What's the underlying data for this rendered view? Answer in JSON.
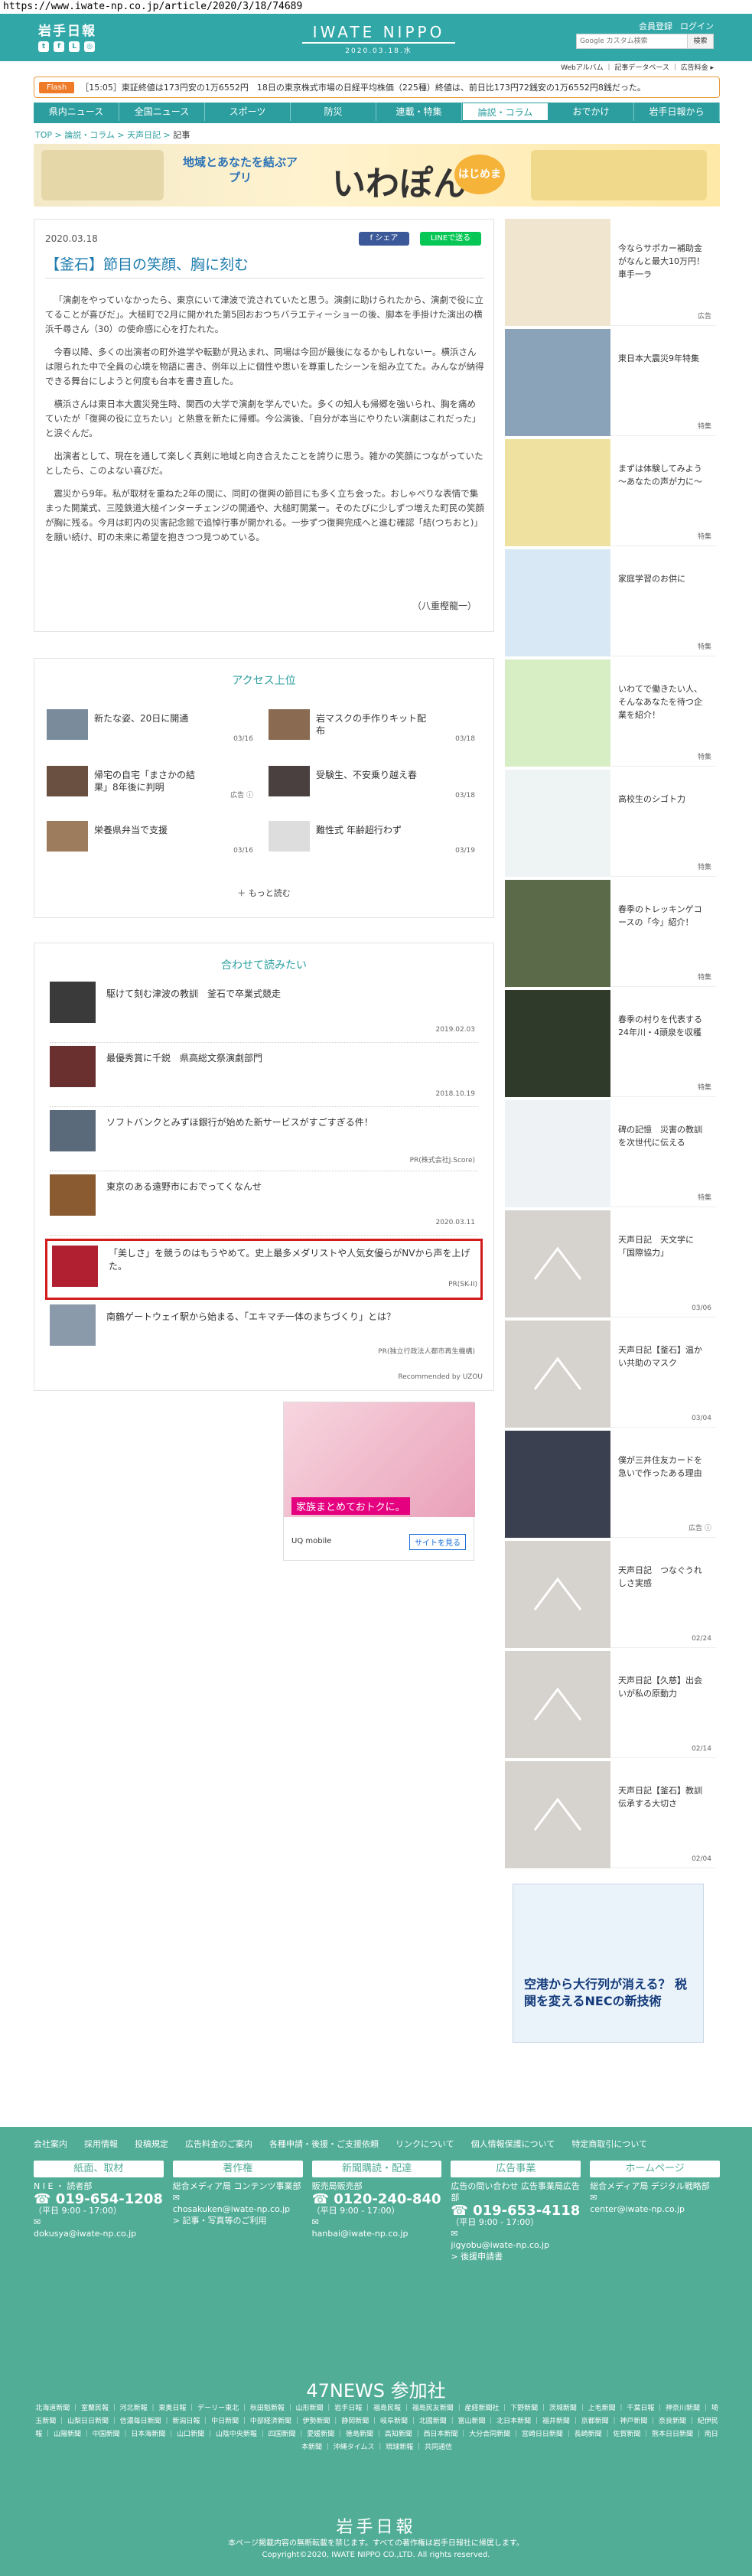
{
  "url": "https://www.iwate-np.co.jp/article/2020/3/18/74689",
  "header": {
    "logo": "岩手日報",
    "brand": "IWATE NIPPO",
    "date": "2020.03.18.水",
    "member": "会員登録",
    "login": "ログイン",
    "search_placeholder": "Google カスタム検索",
    "search_btn": "検索",
    "sub": "Webアルバム ｜ 記事データベース ｜ 広告料金 ▸"
  },
  "flash": {
    "tag": "Flash",
    "text": "［15:05］東証終値は173円安の1万6552円　18日の東京株式市場の日経平均株価（225種）終値は、前日比173円72銭安の1万6552円8銭だった。"
  },
  "nav": [
    "県内ニュース",
    "全国ニュース",
    "スポーツ",
    "防災",
    "連載・特集",
    "論説・コラム",
    "おでかけ",
    "岩手日報から"
  ],
  "breadcrumb": {
    "a": "TOP",
    "b": "論説・コラム",
    "c": "天声日記",
    "d": "記事"
  },
  "banner": {
    "t1": "地域とあなたを結ぶアプリ",
    "t2": "いわぽん",
    "t3": "はじめました"
  },
  "article": {
    "date": "2020.03.18",
    "share": "シェア",
    "line": "LINEで送る",
    "title": "【釜石】節目の笑顔、胸に刻む",
    "paras": [
      "「演劇をやっていなかったら、東京にいて津波で流されていたと思う。演劇に助けられたから、演劇で役に立てることが喜びだ」。大槌町で2月に開かれた第5回おおつちバラエティーショーの後、脚本を手掛けた演出の横浜千尋さん（30）の使命感に心を打たれた。",
      "今春以降、多くの出演者の町外進学や転勤が見込まれ、同場は今回が最後になるかもしれないー。横浜さんは限られた中で全員の心境を物語に書き、例年以上に個性や思いを尊重したシーンを組み立てた。みんなが納得できる舞台にしようと何度も台本を書き直した。",
      "横浜さんは東日本大震災発生時、関西の大学で演劇を学んでいた。多くの知人も帰郷を強いられ、胸を痛めていたが「復興の役に立ちたい」と熱意を新たに帰郷。今公演後、「自分が本当にやりたい演劇はこれだった」と涙ぐんだ。",
      "出演者として、現在を通して楽しく真剣に地域と向き合えたことを誇りに思う。雑かの笑顔につながっていたとしたら、このよない喜びだ。",
      "震災から9年。私が取材を重ねた2年の間に、同町の復興の節目にも多く立ち会った。おしゃべりな表情で集まった開業式、三陸鉄道大槌インターチェンジの開通や、大槌町開業ー。そのたびに少しずつ増えた町民の笑顔が胸に残る。今月は町内の災害記念館で追悼行事が開かれる。一歩ずつ復興完成へと進む確認「結(つちおと)」を願い続け、町の未来に希望を抱きつつ見つめている。"
    ],
    "signature": "（八重樫龍一）"
  },
  "ranking": {
    "title": "アクセス上位",
    "items": [
      {
        "t": "新たな姿、20日に開通",
        "d": "03/16"
      },
      {
        "t": "岩マスクの手作りキット配布",
        "d": "03/18"
      },
      {
        "t": "帰宅の自宅「まさかの結果」8年後に判明",
        "d": "広告 ⓘ"
      },
      {
        "t": "受験生、不安乗り越え春",
        "d": "03/18"
      },
      {
        "t": "栄養県弁当で支援",
        "d": "03/16"
      },
      {
        "t": "難性式 年齢超行わず",
        "d": "03/19"
      }
    ],
    "more": "もっと読む"
  },
  "related": {
    "title": "合わせて読みたい",
    "items": [
      {
        "t": "駆けて刻む津波の教訓　釜石で卒業式競走",
        "d": "2019.02.03"
      },
      {
        "t": "最優秀賞に千鋭　県高総文祭演劇部門",
        "d": "2018.10.19"
      },
      {
        "t": "ソフトバンクとみずほ銀行が始めた新サービスがすごすぎる件！",
        "d": "PR(株式会社J.Score)"
      },
      {
        "t": "東京のある遠野市におでってくなんせ",
        "d": "2020.03.11"
      },
      {
        "t": "「美しさ」を競うのはもうやめて。史上最多メダリストや人気女優らがNVから声を上げた。",
        "d": "PR(SK-II)"
      },
      {
        "t": "南鶴ゲートウェイ駅から始まる、「エキマチ一体のまちづくり」とは？",
        "d": "PR(独立行政法人都市再生機構)"
      }
    ],
    "recommended": "Recommended by UZOU"
  },
  "ad": {
    "text": "家族まとめておトクに。",
    "brand": "UQ mobile",
    "cta": "サイトを見る"
  },
  "sidebar": [
    {
      "t": "今ならサポカー補助金がなんと最大10万円！車手一ラ",
      "tag": "広告"
    },
    {
      "t": "東日本大震災9年特集",
      "tag": "特集"
    },
    {
      "t": "まずは体験してみよう～あなたの声が力に～",
      "tag": "特集"
    },
    {
      "t": "家庭学習のお供に",
      "tag": "特集"
    },
    {
      "t": "いわてで働きたい人、そんなあなたを待つ企業を紹介！",
      "tag": "特集"
    },
    {
      "t": "高校生のシゴト力",
      "tag": "特集"
    },
    {
      "t": "春季のトレッキンゲコースの「今」紹介！",
      "tag": "特集"
    },
    {
      "t": "春季の村りを代表する24年川・4頭泉を収穫",
      "tag": "特集"
    },
    {
      "t": "碑の記憶　災害の教訓を次世代に伝える",
      "tag": "特集"
    },
    {
      "t": "天声日記　天文学に「国際協力」",
      "tag": "03/06"
    },
    {
      "t": "天声日記【釜石】温かい共助のマスク",
      "tag": "03/04"
    },
    {
      "t": "僕が三井住友カードを急いで作ったある理由",
      "tag": "広告 ⓘ"
    },
    {
      "t": "天声日記　つなぐうれしさ実感",
      "tag": "02/24"
    },
    {
      "t": "天声日記【久慈】出会いが私の原動力",
      "tag": "02/14"
    },
    {
      "t": "天声日記【釜石】教訓伝承する大切さ",
      "tag": "02/04"
    },
    {
      "t": "空港から大行列が消える？ 税関を変えるNECの新技術",
      "tag": ""
    }
  ],
  "footer": {
    "links": [
      "会社案内",
      "採用情報",
      "投稿規定",
      "広告料金のご案内",
      "各種申請・後援・ご支援依頼",
      "リンクについて",
      "個人情報保護について",
      "特定商取引について"
    ],
    "cols": [
      {
        "h": "紙面、取材",
        "sub": "N I E ・ 読者部",
        "tel": "019-654-1208",
        "hours": "（平日 9:00 - 17:00）",
        "mail": "dokusya@iwate-np.co.jp"
      },
      {
        "h": "著作権",
        "sub": "総合メディア局 コンテンツ事業部",
        "tel": "",
        "hours": "",
        "mail": "chosakuken@iwate-np.co.jp",
        "extra": "> 記事・写真等のご利用"
      },
      {
        "h": "新聞購読・配達",
        "sub": "販売局販売部",
        "tel": "0120-240-840",
        "hours": "（平日 9:00 - 17:00）",
        "mail": "hanbai@iwate-np.co.jp"
      },
      {
        "h": "広告事業",
        "sub": "広告の問い合わせ 広告事業局広告部",
        "tel": "019-653-4118",
        "hours": "（平日 9:00 - 17:00）",
        "mail": "jigyobu@iwate-np.co.jp",
        "extra": "> 後援申請書"
      },
      {
        "h": "ホームページ",
        "sub": "総合メディア局 デジタル戦略部",
        "tel": "",
        "hours": "",
        "mail": "center@iwate-np.co.jp"
      }
    ],
    "n47": "47NEWS 参加社",
    "n47list": "北海道新聞 ｜ 室蘭民報 ｜ 河北新報 ｜ 東奥日報 ｜ デーリー東北 ｜ 秋田魁新報 ｜ 山形新聞 ｜ 岩手日報 ｜ 福島民報 ｜ 福島民友新聞 ｜ 産経新聞社 ｜ 下野新聞 ｜ 茨城新聞 ｜ 上毛新聞 ｜ 千葉日報 ｜ 神奈川新聞 ｜ 埼玉新聞 ｜ 山梨日日新聞 ｜ 信濃毎日新聞 ｜ 新潟日報 ｜ 中日新聞 ｜ 中部経済新聞 ｜ 伊勢新聞 ｜ 静岡新聞 ｜ 岐阜新聞 ｜ 北國新聞 ｜ 富山新聞 ｜ 北日本新聞 ｜ 福井新聞 ｜ 京都新聞 ｜ 神戸新聞 ｜ 奈良新聞 ｜ 紀伊民報 ｜ 山陽新聞 ｜ 中国新聞 ｜ 日本海新聞 ｜ 山口新聞 ｜ 山陰中央新報 ｜ 四国新聞 ｜ 愛媛新聞 ｜ 徳島新聞 ｜ 高知新聞 ｜ 西日本新聞 ｜ 大分合同新聞 ｜ 宮崎日日新聞 ｜ 長崎新聞 ｜ 佐賀新聞 ｜ 熊本日日新聞 ｜ 南日本新聞 ｜ 沖縄タイムス ｜ 琉球新報 ｜ 共同通信",
    "logo": "岩手日報",
    "notice": "本ページ掲載内容の無断転載を禁じます。すべての著作権は岩手日報社に帰属します。",
    "copy": "Copyright©2020, IWATE NIPPO CO.,LTD. All rights reserved."
  }
}
